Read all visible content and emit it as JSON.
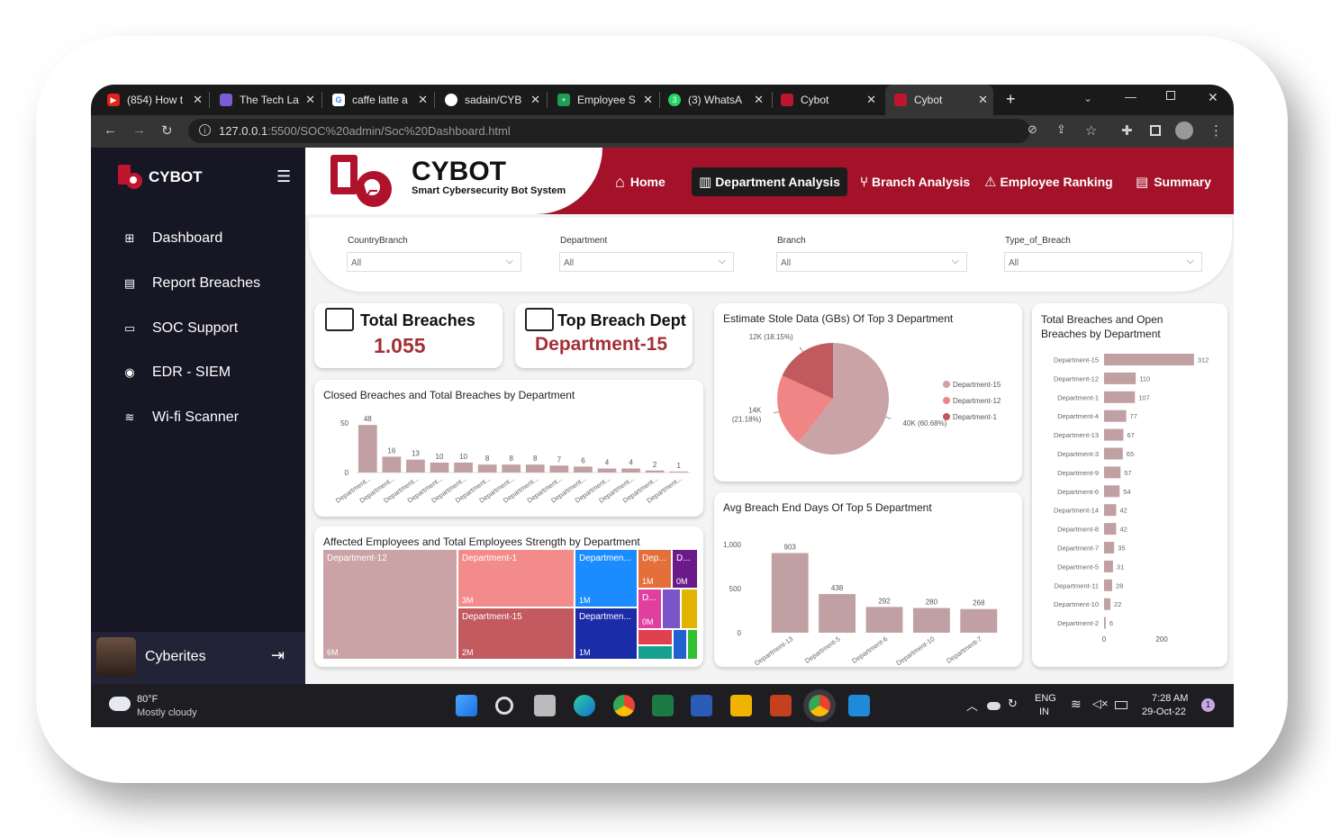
{
  "browser": {
    "tabs": [
      {
        "label": "(854) How t",
        "color": "#e62117"
      },
      {
        "label": "The Tech La",
        "color": "#7a5cd6"
      },
      {
        "label": "caffe latte a",
        "color": "#4285f4"
      },
      {
        "label": "sadain/CYB",
        "color": "#ffffff"
      },
      {
        "label": "Employee S",
        "color": "#1e9e54"
      },
      {
        "label": "(3) WhatsA",
        "color": "#25d366"
      },
      {
        "label": "Cybot",
        "color": "#c0152f"
      },
      {
        "label": "Cybot",
        "color": "#c0152f"
      }
    ],
    "url_host": "127.0.0.1",
    "url_path": ":5500/SOC%20admin/Soc%20Dashboard.html"
  },
  "sidebar": {
    "brand": "CYBOT",
    "items": [
      {
        "label": "Dashboard",
        "icon": "grid-icon"
      },
      {
        "label": "Report Breaches",
        "icon": "file-icon"
      },
      {
        "label": "SOC Support",
        "icon": "message-icon"
      },
      {
        "label": "EDR - SIEM",
        "icon": "radar-icon"
      },
      {
        "label": "Wi-fi Scanner",
        "icon": "wifi-icon"
      }
    ],
    "user": "Cyberites"
  },
  "header": {
    "title": "CYBOT",
    "subtitle": "Smart Cybersecurity Bot System",
    "nav": [
      "Home",
      "Department Analysis",
      "Branch Analysis",
      "Employee Ranking",
      "Summary"
    ]
  },
  "filters": [
    {
      "label": "CountryBranch",
      "value": "All"
    },
    {
      "label": "Department",
      "value": "All"
    },
    {
      "label": "Branch",
      "value": "All"
    },
    {
      "label": "Type_of_Breach",
      "value": "All"
    }
  ],
  "kpis": [
    {
      "title": "Total Breaches",
      "value": "1.055"
    },
    {
      "title": "Top Breach Dept",
      "value": "Department-15"
    }
  ],
  "chart_data": [
    {
      "type": "bar",
      "title": "Closed Breaches and Total Breaches by Department",
      "categories": [
        "Department...",
        "Department...",
        "Department...",
        "Department...",
        "Department...",
        "Department...",
        "Department...",
        "Department...",
        "Department...",
        "Department...",
        "Department...",
        "Department...",
        "Department...",
        "Department..."
      ],
      "values": [
        48,
        16,
        13,
        10,
        10,
        8,
        8,
        8,
        7,
        6,
        4,
        4,
        2,
        1
      ],
      "yticks": [
        0,
        50
      ],
      "ylim": [
        0,
        50
      ],
      "color": "#c1a0a3"
    },
    {
      "type": "pie",
      "title": "Estimate Stole Data (GBs) Of Top 3 Department",
      "labels": [
        "Department-15",
        "Department-12",
        "Department-1"
      ],
      "values": [
        40,
        14,
        12
      ],
      "data_labels": [
        "40K (60.68%)",
        "14K (21.18%)",
        "12K (18.15%)"
      ],
      "colors": [
        "#c9a3a6",
        "#f08585",
        "#c05a5f"
      ],
      "legend": "right"
    },
    {
      "type": "bar",
      "title": "Total Breaches and Open Breaches by Department",
      "orientation": "horizontal",
      "categories": [
        "Department-15",
        "Department-12",
        "Department-1",
        "Department-4",
        "Department-13",
        "Department-3",
        "Department-9",
        "Department-6",
        "Department-14",
        "Department-8",
        "Department-7",
        "Department-5",
        "Department-11",
        "Department-10",
        "Department-2"
      ],
      "values": [
        312,
        110,
        107,
        77,
        67,
        65,
        57,
        54,
        42,
        42,
        35,
        31,
        28,
        22,
        6
      ],
      "xticks": [
        0,
        200
      ],
      "color": "#c1a0a3"
    },
    {
      "type": "bar",
      "title": "Avg Breach End Days Of Top 5 Department",
      "categories": [
        "Department-13",
        "Department-5",
        "Department-6",
        "Department-10",
        "Department-7"
      ],
      "values": [
        903,
        438,
        292,
        280,
        268
      ],
      "yticks": [
        "0",
        "500",
        "1,000"
      ],
      "ylim": [
        0,
        1000
      ],
      "color": "#c1a0a3"
    },
    {
      "type": "treemap",
      "title": "Affected Employees and Total Employees Strength by Department",
      "cells": [
        {
          "label": "Department-12",
          "value": "6M",
          "color": "#c9a3a6"
        },
        {
          "label": "Department-1",
          "value": "3M",
          "color": "#f48b8b"
        },
        {
          "label": "Department-15",
          "value": "2M",
          "color": "#c25a60"
        },
        {
          "label": "Departmen...",
          "value": "1M",
          "color": "#1a8cff"
        },
        {
          "label": "Departmen...",
          "value": "1M",
          "color": "#1a2ca8"
        },
        {
          "label": "Dep...",
          "value": "1M",
          "color": "#e46f3a"
        },
        {
          "label": "D...",
          "value": "0M",
          "color": "#6b1a8a"
        },
        {
          "label": "D...",
          "value": "0M",
          "color": "#e03fa0"
        },
        {
          "label": "",
          "value": "",
          "color": "#7a55c8"
        },
        {
          "label": "",
          "value": "",
          "color": "#e0b400"
        },
        {
          "label": "",
          "value": "",
          "color": "#e04050"
        },
        {
          "label": "",
          "value": "",
          "color": "#16a090"
        },
        {
          "label": "",
          "value": "",
          "color": "#2060d0"
        },
        {
          "label": "",
          "value": "",
          "color": "#30c030"
        }
      ]
    }
  ],
  "taskbar": {
    "weather_temp": "80°F",
    "weather_desc": "Mostly cloudy",
    "lang1": "ENG",
    "lang2": "IN",
    "time": "7:28 AM",
    "date": "29-Oct-22",
    "badge": "1"
  }
}
